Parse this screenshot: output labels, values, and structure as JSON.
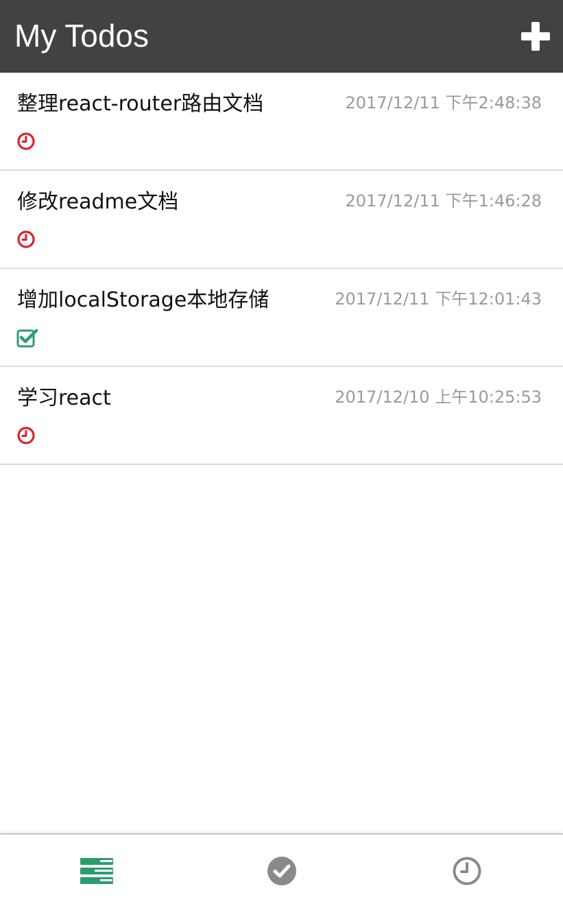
{
  "header": {
    "title": "My Todos",
    "add_icon": "plus-icon"
  },
  "colors": {
    "header_bg": "#424242",
    "pending": "#e0202a",
    "done": "#2a9d6f",
    "tab_active": "#2a9d6f",
    "tab_inactive": "#8a8a8a",
    "time_text": "#9a9a9a"
  },
  "todos": [
    {
      "title": "整理react-router路由文档",
      "time": "2017/12/11 下午2:48:38",
      "status": "pending",
      "status_icon": "clock-icon"
    },
    {
      "title": "修改readme文档",
      "time": "2017/12/11 下午1:46:28",
      "status": "pending",
      "status_icon": "clock-icon"
    },
    {
      "title": "增加localStorage本地存储",
      "time": "2017/12/11 下午12:01:43",
      "status": "done",
      "status_icon": "checkbox-checked-icon"
    },
    {
      "title": "学习react",
      "time": "2017/12/10 上午10:25:53",
      "status": "pending",
      "status_icon": "clock-icon"
    }
  ],
  "tabs": [
    {
      "id": "all",
      "icon": "list-icon",
      "active": true
    },
    {
      "id": "done",
      "icon": "check-circle-icon",
      "active": false
    },
    {
      "id": "pending",
      "icon": "clock-icon",
      "active": false
    }
  ]
}
